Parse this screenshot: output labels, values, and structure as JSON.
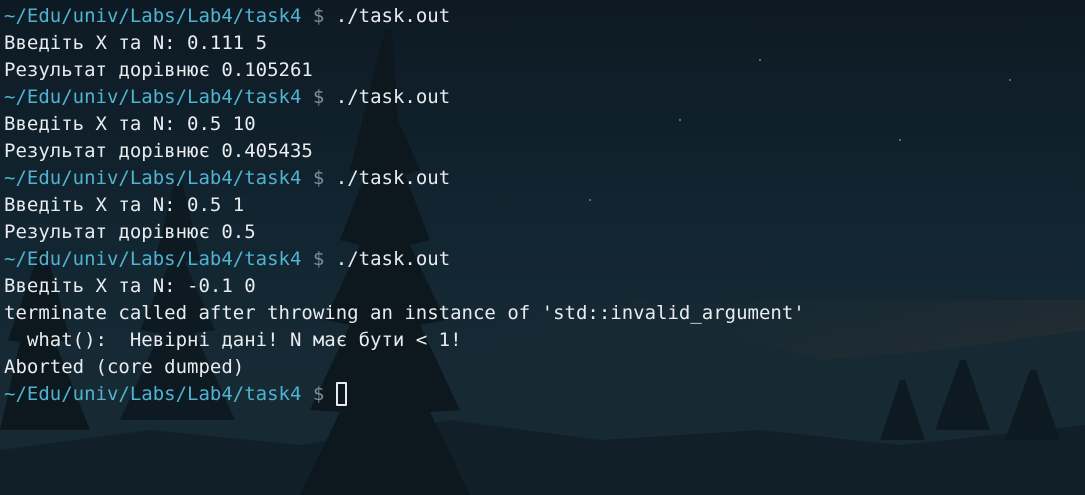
{
  "terminal": {
    "prompt_path": "~/Edu/univ/Labs/Lab4/task4",
    "prompt_symbol": "$",
    "lines": [
      {
        "kind": "prompt",
        "command": "./task.out"
      },
      {
        "kind": "output",
        "text": "Введіть X та N: 0.111 5"
      },
      {
        "kind": "output",
        "text": "Результат дорівнює 0.105261"
      },
      {
        "kind": "prompt",
        "command": "./task.out"
      },
      {
        "kind": "output",
        "text": "Введіть X та N: 0.5 10"
      },
      {
        "kind": "output",
        "text": "Результат дорівнює 0.405435"
      },
      {
        "kind": "prompt",
        "command": "./task.out"
      },
      {
        "kind": "output",
        "text": "Введіть X та N: 0.5 1"
      },
      {
        "kind": "output",
        "text": "Результат дорівнює 0.5"
      },
      {
        "kind": "prompt",
        "command": "./task.out"
      },
      {
        "kind": "output",
        "text": "Введіть X та N: -0.1 0"
      },
      {
        "kind": "output",
        "text": "terminate called after throwing an instance of 'std::invalid_argument'"
      },
      {
        "kind": "output",
        "text": "  what():  Невірні дані! N має бути < 1!"
      },
      {
        "kind": "output",
        "text": "Aborted (core dumped)"
      },
      {
        "kind": "prompt",
        "command": "",
        "cursor": true
      }
    ]
  },
  "colors": {
    "background": "#0f1d27",
    "path": "#4fb3d1",
    "text": "#e9ecef",
    "prompt_symbol": "#7a8f9a"
  }
}
